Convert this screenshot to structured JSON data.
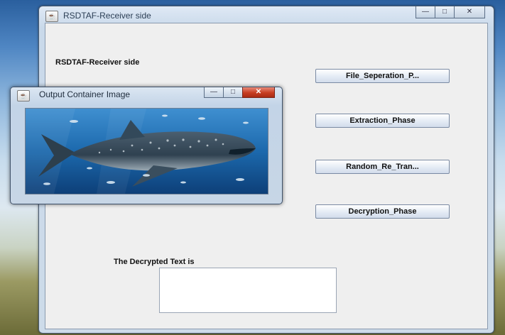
{
  "main_window": {
    "title": "RSDTAF-Receiver side",
    "controls": {
      "minimize": "—",
      "maximize": "□",
      "close": "✕"
    },
    "heading": "RSDTAF-Receiver side",
    "buttons": [
      {
        "label": "File_Seperation_P..."
      },
      {
        "label": "Extraction_Phase"
      },
      {
        "label": "Random_Re_Tran..."
      },
      {
        "label": "Decryption_Phase"
      }
    ],
    "decrypted_label": "The Decrypted Text is",
    "decrypted_text": ""
  },
  "popup_window": {
    "title": "Output Container Image",
    "controls": {
      "minimize": "—",
      "maximize": "□",
      "close": "✕"
    },
    "image_icon": "java-coffee-icon",
    "image_subject": "whale-shark-underwater-photo"
  },
  "colors": {
    "frame": "#c9d9ea",
    "client": "#efefef",
    "popup_close": "#c73d22",
    "water": "#1d5f9a"
  }
}
